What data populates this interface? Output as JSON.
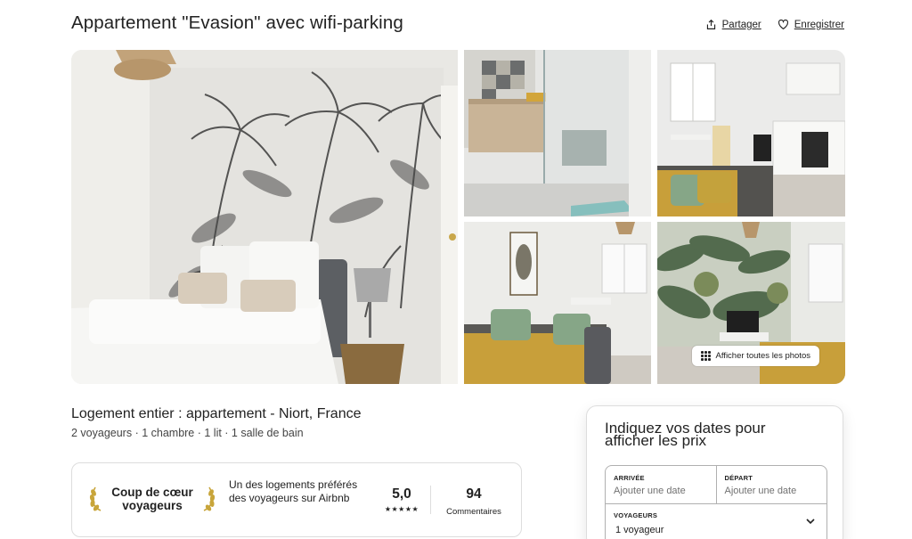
{
  "header": {
    "title": "Appartement \"Evasion\" avec wifi-parking",
    "share_label": "Partager",
    "save_label": "Enregistrer"
  },
  "gallery": {
    "show_all_label": "Afficher toutes les photos"
  },
  "listing": {
    "title": "Logement entier : appartement - Niort, France",
    "details": "2 voyageurs · 1 chambre · 1 lit · 1 salle de bain"
  },
  "guest_favorite": {
    "badge": "Coup de cœur voyageurs",
    "description": "Un des logements préférés des voyageurs sur Airbnb",
    "rating": "5,0",
    "stars": "★★★★★",
    "reviews_count": "94",
    "reviews_label": "Commentaires"
  },
  "booking": {
    "title": "Indiquez vos dates pour afficher les prix",
    "checkin_label": "ARRIVÉE",
    "checkin_placeholder": "Ajouter une date",
    "checkout_label": "DÉPART",
    "checkout_placeholder": "Ajouter une date",
    "guests_label": "VOYAGEURS",
    "guests_value": "1 voyageur"
  },
  "icons": {
    "share": "share-icon",
    "save": "heart-icon",
    "grid": "grid-dots-icon",
    "laurel": "laurel-icon",
    "chevron": "chevron-down-icon"
  },
  "colors": {
    "text": "#222222",
    "muted": "#717171",
    "border": "#dddddd",
    "accent_gold": "#c8a53a"
  }
}
